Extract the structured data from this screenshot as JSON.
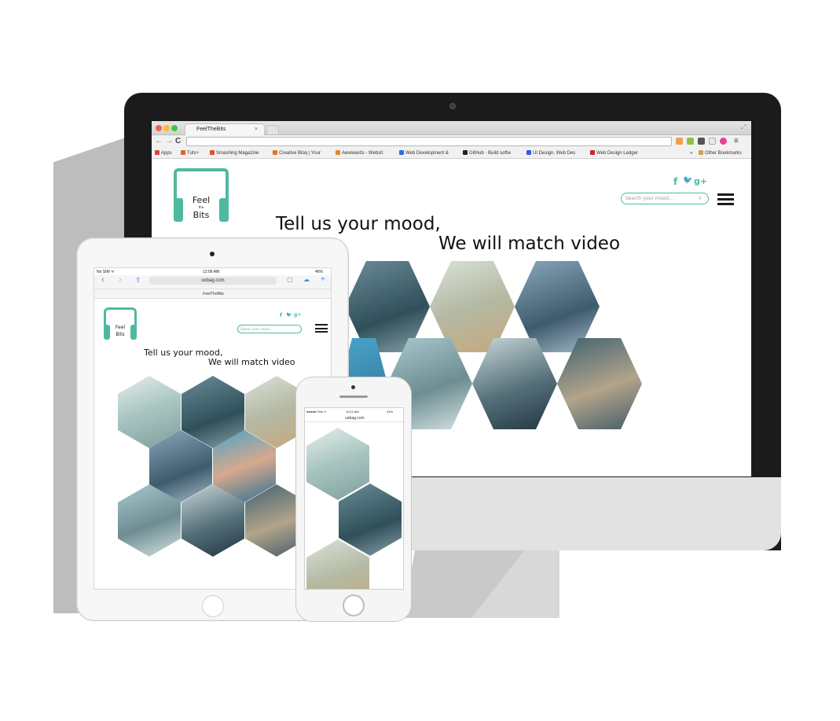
{
  "browser": {
    "tab_title": "FeelTheBits",
    "tab_close": "×",
    "url": "",
    "apps_label": "Apps",
    "bookmarks": [
      {
        "label": "Tuts+",
        "color": "#e2622d"
      },
      {
        "label": "Smashing Magazine",
        "color": "#e84b2d"
      },
      {
        "label": "Creative Bloq | Your",
        "color": "#e8702d"
      },
      {
        "label": "Awwwards - Websit",
        "color": "#e08a2d"
      },
      {
        "label": "Web Development &",
        "color": "#2d6fe0"
      },
      {
        "label": "GitHub · Build softw",
        "color": "#222222"
      },
      {
        "label": "UI Design, Web Des",
        "color": "#2d5fe0"
      },
      {
        "label": "Web Design Ledger",
        "color": "#c8262d"
      }
    ],
    "bookmarks_overflow": "»",
    "other_bookmarks": "Other Bookmarks"
  },
  "site": {
    "logo_top": "Feel",
    "logo_mid": "the",
    "logo_bottom": "Bits",
    "social": [
      "f",
      "🐦",
      "g+"
    ],
    "search_placeholder": "Search your mood...",
    "tagline_1": "Tell us your mood,",
    "tagline_2": "We will match video",
    "colors": {
      "accent": "#4eb9a0",
      "tint": "#8cb7c2"
    }
  },
  "ipad": {
    "carrier": "No SIM ᯤ",
    "time": "12:06 AM",
    "battery": "46%",
    "url": "uxbag.com",
    "page_title": "FeelTheBits"
  },
  "iphone": {
    "carrier": "●●●●● Fido ᯤ",
    "time": "10:11 AM",
    "battery": "43%",
    "url": "uxbag.com"
  },
  "apple_logo": ""
}
